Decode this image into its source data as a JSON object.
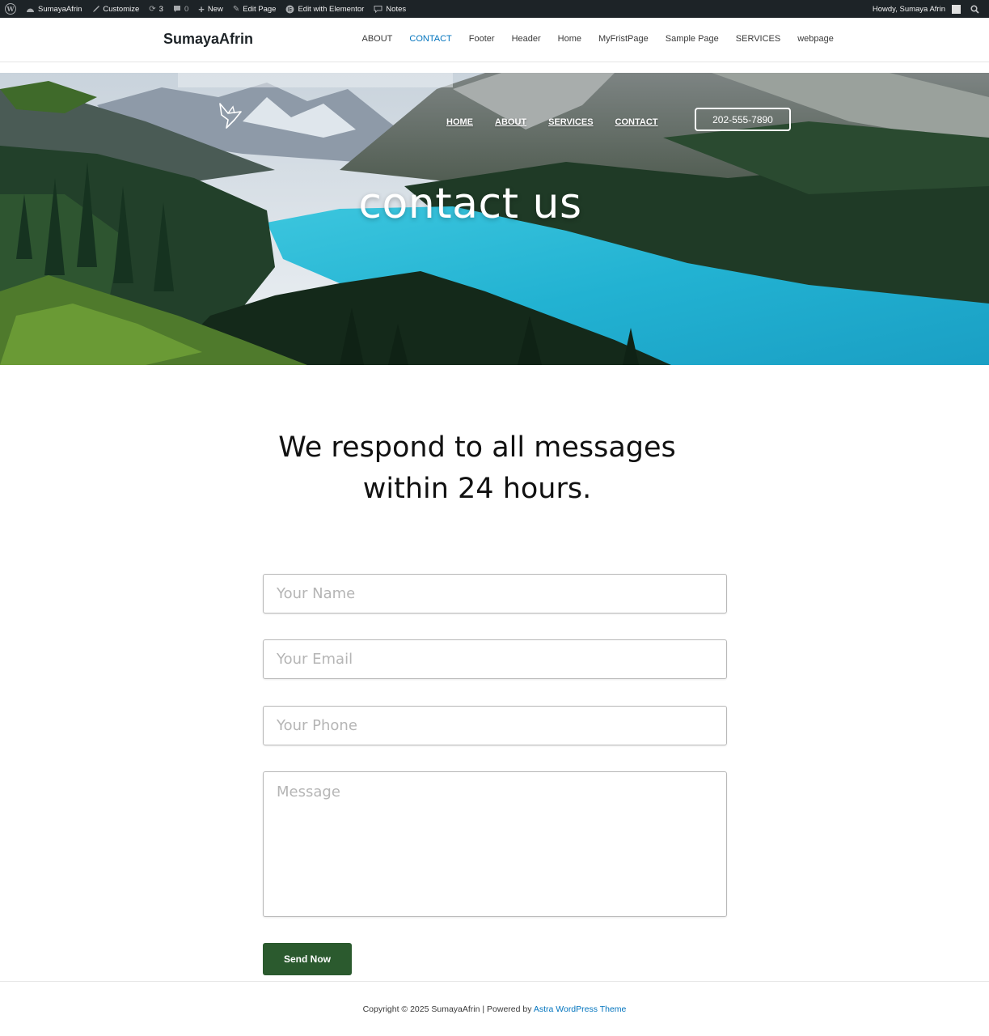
{
  "adminbar": {
    "site_name": "SumayaAfrin",
    "customize": "Customize",
    "updates_count": "3",
    "comments_count": "0",
    "new_label": "New",
    "edit_page": "Edit Page",
    "edit_elementor": "Edit with Elementor",
    "notes": "Notes",
    "howdy": "Howdy, Sumaya Afrin"
  },
  "header": {
    "site_title": "SumayaAfrin",
    "nav": [
      "ABOUT",
      "CONTACT",
      "Footer",
      "Header",
      "Home",
      "MyFristPage",
      "Sample Page",
      "SERVICES",
      "webpage"
    ],
    "active_index": 1
  },
  "hero": {
    "nav": [
      "HOME",
      "ABOUT",
      "SERVICES",
      "CONTACT"
    ],
    "phone": "202-555-7890",
    "title": "contact us"
  },
  "main": {
    "heading_line1": "We respond to all messages",
    "heading_line2": "within 24 hours.",
    "form": {
      "name_placeholder": "Your Name",
      "email_placeholder": "Your Email",
      "phone_placeholder": "Your Phone",
      "message_placeholder": "Message",
      "submit_label": "Send Now"
    }
  },
  "footer": {
    "copyright": "Copyright © 2025 SumayaAfrin | Powered by",
    "theme_link": "Astra WordPress Theme"
  },
  "colors": {
    "adminbar_bg": "#1d2327",
    "nav_active": "#0274be",
    "button_bg": "#2b5a2e",
    "lake": "#2bb7d4"
  }
}
